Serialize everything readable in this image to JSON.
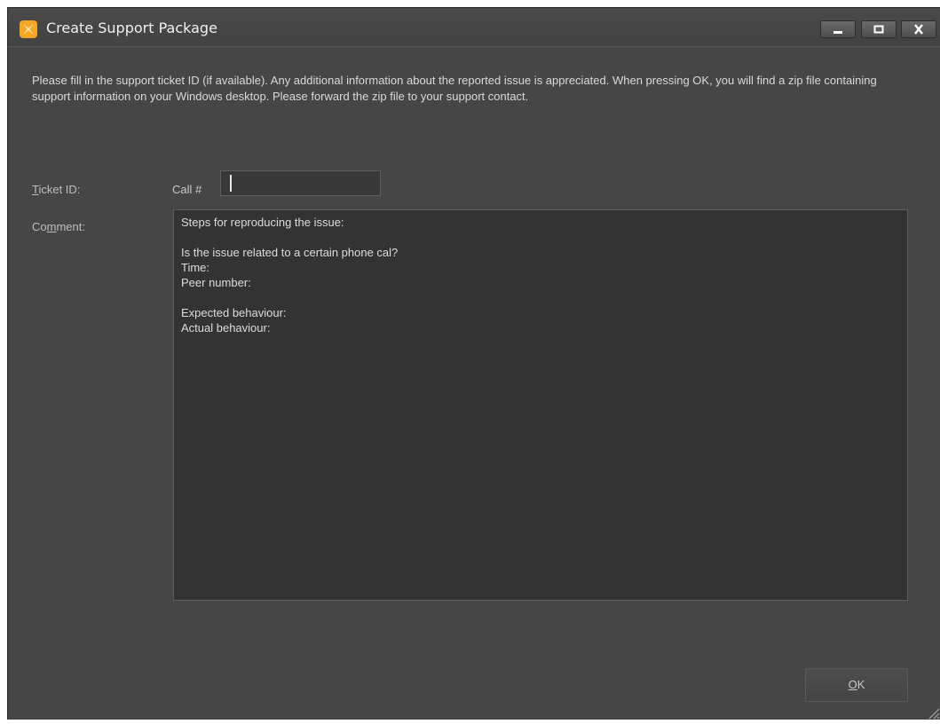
{
  "window": {
    "title": "Create Support Package",
    "controls": {
      "minimize_icon": "minimize-icon",
      "maximize_icon": "maximize-icon",
      "close_icon": "close-icon"
    }
  },
  "info_text": "Please fill in the support ticket ID (if available). Any additional information about the reported issue is appreciated. When pressing OK, you will find a zip file containing support information on your Windows desktop. Please forward the zip file to your support contact.",
  "form": {
    "ticket_label": "Ticket ID:",
    "ticket_label_mnemonic": "T",
    "ticket_label_rest": "icket ID:",
    "call_prefix": "Call #",
    "ticket_value": "",
    "comment_label_pre": "Co",
    "comment_label_mnemonic": "m",
    "comment_label_post": "ment:",
    "comment_value": "Steps for reproducing the issue:\n\nIs the issue related to a certain phone cal?\nTime:\nPeer number:\n\nExpected behaviour:\nActual behaviour:"
  },
  "ok_button": {
    "mnemonic": "O",
    "rest": "K"
  },
  "colors": {
    "window_bg": "#464646",
    "field_bg": "#333333",
    "icon_orange": "#f5a623"
  }
}
